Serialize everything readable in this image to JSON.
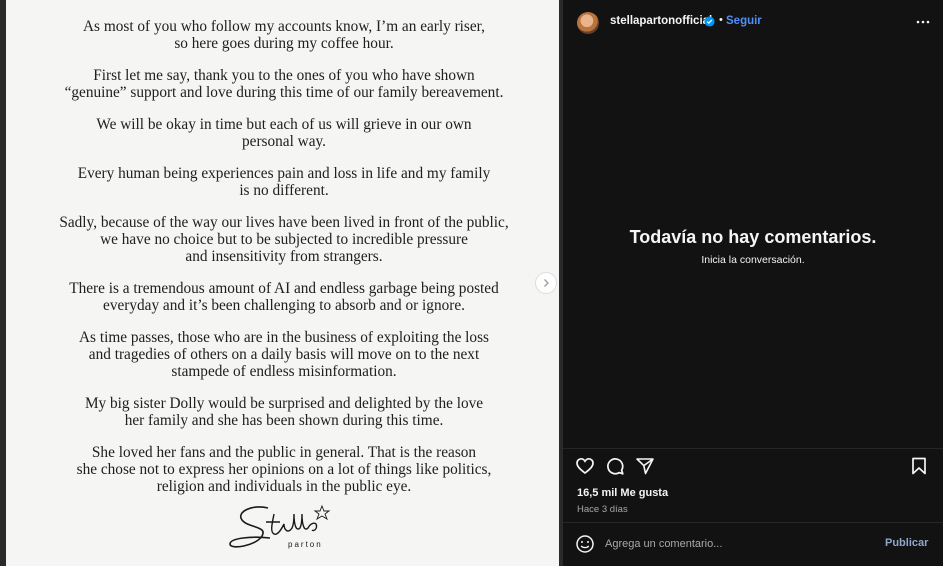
{
  "letter": {
    "paragraphs": [
      [
        "As most of you who follow my accounts know, I’m an early riser,",
        "so here goes during my coffee hour."
      ],
      [
        "First let me say, thank you to the ones of you who have shown",
        "“genuine” support and love during this time of our family bereavement."
      ],
      [
        "We will be okay in time but each of us will grieve in our own",
        "personal way."
      ],
      [
        "Every human being experiences pain and loss in life and my family",
        "is no different."
      ],
      [
        "Sadly, because of the way our lives have been lived in front of the public,",
        "we have no choice but to be subjected to incredible pressure",
        "and insensitivity from strangers."
      ],
      [
        "There is a tremendous amount of AI and endless garbage being posted",
        "everyday and it’s been challenging to absorb and or ignore."
      ],
      [
        "As time passes, those who are in the business of exploiting the loss",
        "and tragedies of others on a daily basis will move on to the next",
        "stampede of endless misinformation."
      ],
      [
        "My big sister Dolly would be surprised and delighted by the love",
        "her family and she has been shown during this time."
      ],
      [
        "She loved her fans and the public in general. That is the reason",
        "she chose not to express her opinions on a lot of things like politics,",
        "religion and individuals in the public eye."
      ]
    ],
    "signature_name": "Stella",
    "signature_sub": "parton"
  },
  "panel": {
    "username": "stellapartonofficial",
    "separator": "•",
    "follow_label": "Seguir",
    "empty_title": "Todavía no hay comentarios.",
    "empty_subtitle": "Inicia la conversación.",
    "likes": "16,5 mil Me gusta",
    "time_ago": "Hace 3 días",
    "comment_placeholder": "Agrega un comentario...",
    "publish_label": "Publicar"
  },
  "icons": {
    "next": "chevron-right-icon",
    "verified": "verified-badge-icon",
    "more": "more-options-icon",
    "like": "heart-icon",
    "comment": "comment-icon",
    "share": "share-icon",
    "save": "bookmark-icon",
    "emoji": "emoji-icon"
  },
  "colors": {
    "accent": "#4f8ff7",
    "panel_bg": "#121212",
    "letter_bg": "#f5f5f3"
  }
}
